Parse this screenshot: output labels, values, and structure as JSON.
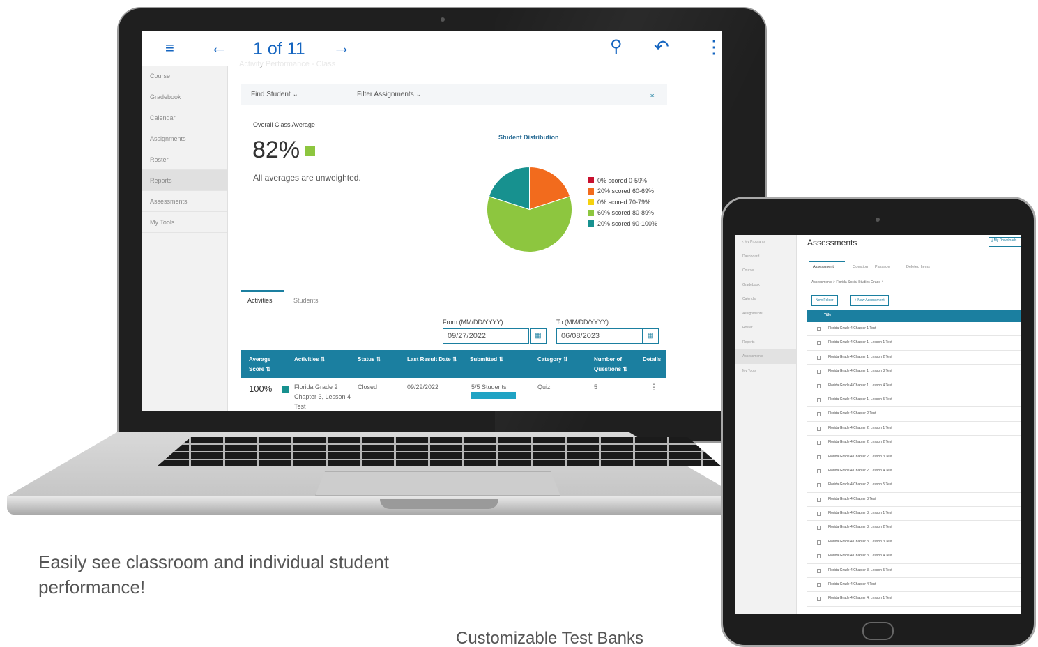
{
  "laptop": {
    "topbar": {
      "menu_icon": "≡",
      "back_icon": "←",
      "page_count": "1 of 11",
      "forward_icon": "→",
      "search_icon": "⚲",
      "reply_icon": "↶",
      "more_icon": "⋮"
    },
    "partial_title": "Activity Performance - Class",
    "sidebar": [
      "Course",
      "Gradebook",
      "Calendar",
      "Assignments",
      "Roster",
      "Reports",
      "Assessments",
      "My Tools"
    ],
    "filters": {
      "find_student": "Find Student ⌄",
      "filter_assignments": "Filter Assignments ⌄",
      "download_icon": "⤓"
    },
    "overall": {
      "label": "Overall Class Average",
      "value": "82%",
      "note": "All averages are unweighted."
    },
    "distribution": {
      "title": "Student Distribution",
      "legend": [
        {
          "label": "0% scored 0-59%",
          "color": "#c8102e",
          "value": 0
        },
        {
          "label": "20% scored 60-69%",
          "color": "#f26b1d",
          "value": 20
        },
        {
          "label": "0% scored 70-79%",
          "color": "#f5d20f",
          "value": 0
        },
        {
          "label": "60% scored 80-89%",
          "color": "#8dc63f",
          "value": 60
        },
        {
          "label": "20% scored 90-100%",
          "color": "#17918f",
          "value": 20
        }
      ]
    },
    "tabs": {
      "activities": "Activities",
      "students": "Students"
    },
    "dates": {
      "from_label": "From (MM/DD/YYYY)",
      "from_value": "09/27/2022",
      "to_label": "To (MM/DD/YYYY)",
      "to_value": "06/08/2023",
      "calendar_icon": "▦"
    },
    "table": {
      "headers": [
        "Average Score ⇅",
        "Activities ⇅",
        "Status ⇅",
        "Last Result Date ⇅",
        "Submitted ⇅",
        "Category ⇅",
        "Number of Questions ⇅",
        "Details"
      ],
      "row": {
        "avg": "100%",
        "activity": "Florida Grade 2 Chapter 3, Lesson 4 Test",
        "status": "Closed",
        "date": "09/29/2022",
        "submitted": "5/5 Students",
        "category": "Quiz",
        "questions": "5",
        "details": "⋮"
      }
    }
  },
  "tablet": {
    "sidebar": [
      "‹ My Programs",
      "Dashboard",
      "Course",
      "Gradebook",
      "Calendar",
      "Assignments",
      "Roster",
      "Reports",
      "Assessments",
      "My Tools"
    ],
    "title": "Assessments",
    "download_label": "⤓ My Downloads",
    "tabs": [
      "Assessment",
      "Question",
      "Passage",
      "Deleted Items"
    ],
    "breadcrumb": "Assessments  >  Florida Social Studies Grade 4",
    "buttons": {
      "new_folder": "New Folder",
      "new_assessment": "+ New Assessment"
    },
    "table_header": "Title",
    "rows": [
      "Florida Grade 4 Chapter 1 Test",
      "Florida Grade 4 Chapter 1, Lesson 1 Test",
      "Florida Grade 4 Chapter 1, Lesson 2 Test",
      "Florida Grade 4 Chapter 1, Lesson 3 Test",
      "Florida Grade 4 Chapter 1, Lesson 4 Test",
      "Florida Grade 4 Chapter 1, Lesson 5 Test",
      "Florida Grade 4 Chapter 2 Test",
      "Florida Grade 4 Chapter 2, Lesson 1 Test",
      "Florida Grade 4 Chapter 2, Lesson 2 Test",
      "Florida Grade 4 Chapter 2, Lesson 3 Test",
      "Florida Grade 4 Chapter 2, Lesson 4 Test",
      "Florida Grade 4 Chapter 2, Lesson 5 Test",
      "Florida Grade 4 Chapter 3 Test",
      "Florida Grade 4 Chapter 3, Lesson 1 Test",
      "Florida Grade 4 Chapter 3, Lesson 2 Test",
      "Florida Grade 4 Chapter 3, Lesson 3 Test",
      "Florida Grade 4 Chapter 3, Lesson 4 Test",
      "Florida Grade 4 Chapter 3, Lesson 5 Test",
      "Florida Grade 4 Chapter 4 Test",
      "Florida Grade 4 Chapter 4, Lesson 1 Test"
    ]
  },
  "captions": {
    "left": "Easily see classroom and individual student performance!",
    "bottom": "Customizable Test Banks"
  }
}
